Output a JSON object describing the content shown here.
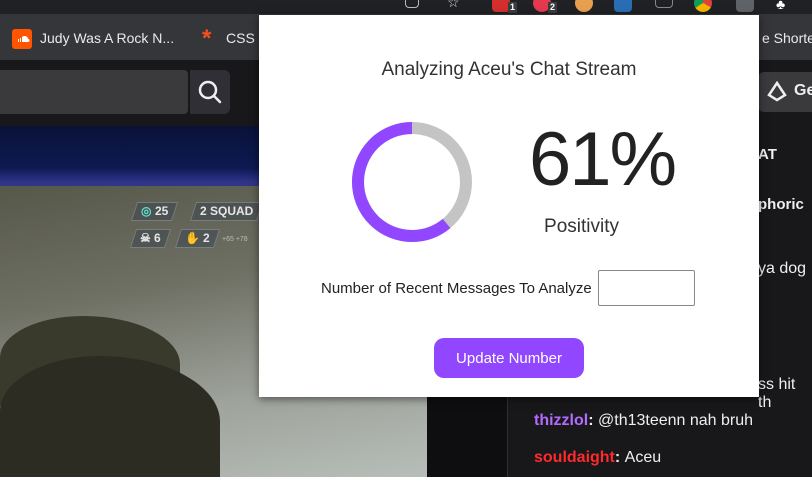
{
  "browser": {
    "bookmarks": [
      {
        "label": "Judy Was A Rock N...",
        "icon": "soundcloud-icon",
        "color": "#ff5500"
      },
      {
        "label": "CSS",
        "icon": "asterisk-icon",
        "color": "#f4511e"
      },
      {
        "label": "e Shorte",
        "icon": "",
        "color": ""
      }
    ],
    "extension_badges": [
      "1",
      "2"
    ]
  },
  "site": {
    "get_bits_label": "Ge",
    "chat_header_peek": "AT",
    "peek_username": "phoric",
    "peek_text_1": "ya dog",
    "peek_text_2": "ss hit th"
  },
  "video_hud": {
    "squad_count": "25",
    "squad_label": "2 SQUAD",
    "kills": "6",
    "assists": "2",
    "small_readout": "+65 +78"
  },
  "chat": [
    {
      "user": "thizzlol",
      "color": "#b36bff",
      "message": "@th13teenn nah bruh"
    },
    {
      "user": "souldaight",
      "color": "#ff2a2a",
      "message": "Aceu"
    }
  ],
  "popup": {
    "title": "Analyzing Aceu's Chat Stream",
    "percent": "61%",
    "positivity_fraction": 0.61,
    "positivity_label": "Positivity",
    "messages_label": "Number of Recent Messages To Analyze",
    "messages_value": "",
    "messages_placeholder": "",
    "update_button": "Update Number",
    "colors": {
      "accent": "#9147ff",
      "track": "#c4c4c4"
    }
  }
}
